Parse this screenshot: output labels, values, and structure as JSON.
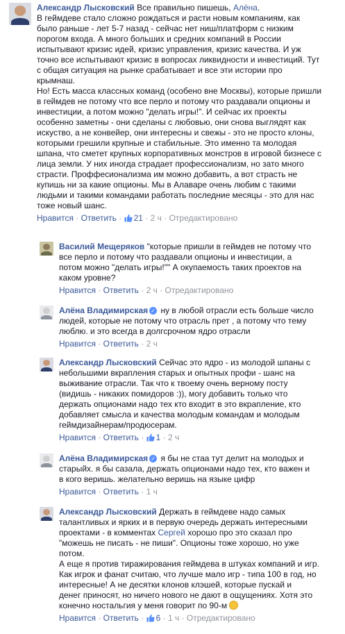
{
  "comments": [
    {
      "author": "Александр Лысковский",
      "verified": false,
      "lines": [
        "Все правильно пишешь, |TAG|.",
        "В геймдеве стало сложно рождаться и расти новым компаниям, как",
        "было раньше - лет 5-7 назад - сейчас нет ниш/платформ с низким",
        "порогом входа. А много больших и средних компаний в России",
        "испытывают кризис идей, кризис управления, кризис качества. И уж",
        "точно все испытывают кризис в вопросах ликвидности и инвестиций. Тут",
        "с общая ситуация на рынке срабатывает и все эти истории про",
        "крымнаш.",
        "Но! Есть масса классных команд (особено вне Москвы), которые пришли",
        "в геймдев не потому что все перло и потому что раздавали опционы и",
        "инвестиции, а потом можно \"делать игры!\". И сейчас их проекты",
        "особенно заметны - они сделаны с любовью, они снова выглядят как",
        "искуство, а не конвейер, они интересны и свежы - это не просто клоны,",
        "которыми грешили крупные и стабильные. Это именно та молодая",
        "шпана, что сметет крупных корпоративных монстров в игровой бизнесе с",
        "лица земли. У них иногда страдает профессионализм, но зато много",
        "страсти. Проффесионализма им можно добавить, а вот страсть не",
        "купишь ни за какие опционы. Мы в Алаваре очень любим с такими",
        "людьми и такими командами работать последние месяцы - это для нас",
        "тоже новый шанс."
      ],
      "tag": "Алёна",
      "like_label": "Нравится",
      "reply_label": "Ответить",
      "likes": "21",
      "time": "2 ч",
      "edited": "Отредактировано"
    },
    {
      "author": "Василий Мещеряков",
      "verified": false,
      "lines": [
        "\"которые пришли в геймдев не потому что",
        "все перло и потому что раздавали опционы и инвестиции, а",
        "потом можно \"делать игры!\"\" А окупаемость таких проектов на",
        "каком уровне?"
      ],
      "like_label": "Нравится",
      "reply_label": "Ответить",
      "likes": "",
      "time": "2 ч",
      "edited": "Отредактировано"
    },
    {
      "author": "Алёна Владимирская",
      "verified": true,
      "lines": [
        "ну в любой отрасли есть больше число",
        "людей, которые не потому что отрасль прет , а потому что тему",
        "люблю. и это всегда в долгсрочном ядро отрасли"
      ],
      "like_label": "Нравится",
      "reply_label": "Ответить",
      "likes": "",
      "time": "2 ч",
      "edited": ""
    },
    {
      "author": "Александр Лысковский",
      "verified": false,
      "lines": [
        "Сейчас это ядро - из молодой шпаны с",
        "небольшими вкрапления старых и опытных профи - шанс на",
        "выживание отрасли. Так что к твоему очень верному посту",
        "(видишь - никаких помидоров :)), могу добавить только что",
        "держать опционами надо тех кто входит в это вкрапление, кто",
        "добавляет смысла и качества молодым командам и молодым",
        "геймдизайнерам/продюсерам."
      ],
      "like_label": "Нравится",
      "reply_label": "Ответить",
      "likes": "1",
      "time": "2 ч",
      "edited": ""
    },
    {
      "author": "Алёна Владимирская",
      "verified": true,
      "lines": [
        "я бы не стаа тут делит на молодых и",
        "старыйх. я бы сазала, держать опционами надо тех, кто важен и",
        "в кого веришь. желательно веришь на языке цифр"
      ],
      "like_label": "Нравится",
      "reply_label": "Ответить",
      "likes": "",
      "time": "1 ч",
      "edited": ""
    },
    {
      "author": "Александр Лысковский",
      "verified": false,
      "lines": [
        "Держать в геймдеве надо самых",
        "талантливых и ярких и в первую очередь держать интересными",
        "проектами - в комментах |TAG| хорошо про это сказал про",
        "\"можешь не писать - не пиши\". Опционы тоже хорошо, но уже",
        "потом.",
        "А еще я против тиражирования геймдева в штуках компаний и игр.",
        "Как игрок и фанат считаю, что лучше мало игр - типа 100 в год, но",
        "интересные! А не десятки клонов клэшей, которые пускай и",
        "денег приносят, но ничего нового не дают в ощущениях. Хотя это",
        "конечно ностальгия у меня говорит по 90-м |EMOJI|"
      ],
      "tag": "Сергей",
      "like_label": "Нравится",
      "reply_label": "Ответить",
      "likes": "6",
      "time": "1 ч",
      "edited": "Отредактировано"
    }
  ],
  "colors": {
    "link": "#3b5998",
    "meta": "#90949c",
    "text": "#141823"
  },
  "icons": {
    "like": "thumbs-up-icon",
    "verified": "verified-badge-icon",
    "emoji": "smile-emoji-icon"
  }
}
